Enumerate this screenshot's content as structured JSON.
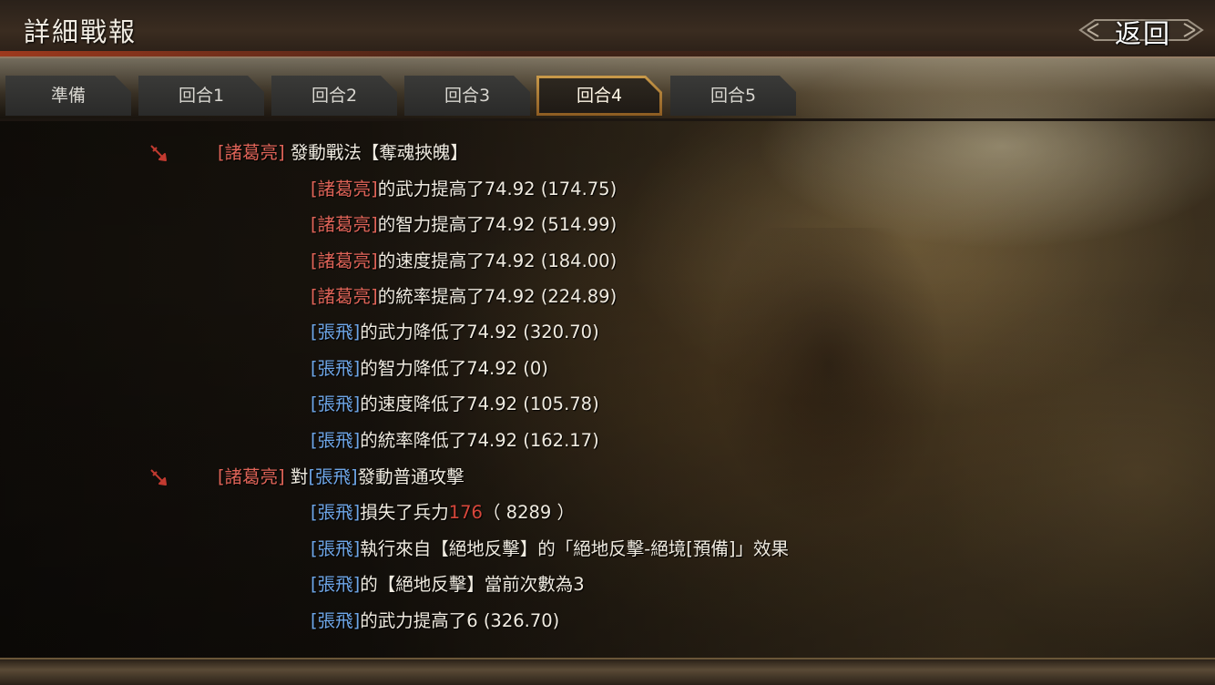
{
  "header": {
    "title": "詳細戰報",
    "back_label": "返回"
  },
  "tabs": [
    {
      "label": "準備",
      "active": false
    },
    {
      "label": "回合1",
      "active": false
    },
    {
      "label": "回合2",
      "active": false
    },
    {
      "label": "回合3",
      "active": false
    },
    {
      "label": "回合4",
      "active": true
    },
    {
      "label": "回合5",
      "active": false
    }
  ],
  "log": {
    "entries": [
      {
        "actor": "[諸葛亮]",
        "text": "發動戰法【奪魂挾魄】",
        "details": [
          {
            "target": "[諸葛亮]",
            "text": "的武力提高了74.92 (174.75)"
          },
          {
            "target": "[諸葛亮]",
            "text": "的智力提高了74.92 (514.99)"
          },
          {
            "target": "[諸葛亮]",
            "text": "的速度提高了74.92 (184.00)"
          },
          {
            "target": "[諸葛亮]",
            "text": "的統率提高了74.92 (224.89)"
          },
          {
            "target": "[張飛]",
            "text": "的武力降低了74.92 (320.70)"
          },
          {
            "target": "[張飛]",
            "text": "的智力降低了74.92 (0)"
          },
          {
            "target": "[張飛]",
            "text": "的速度降低了74.92 (105.78)"
          },
          {
            "target": "[張飛]",
            "text": "的統率降低了74.92 (162.17)"
          }
        ]
      },
      {
        "actor": "[諸葛亮]",
        "text_prefix": "對",
        "target": "[張飛]",
        "text": "發動普通攻擊",
        "details": [
          {
            "target": "[張飛]",
            "text_before": "損失了兵力",
            "damage": "176",
            "text_after": "（ 8289 ）"
          },
          {
            "target": "[張飛]",
            "text": "執行來自【絕地反擊】的「絕地反擊-絕境[預備]」效果"
          },
          {
            "target": "[張飛]",
            "text": "的【絕地反擊】當前次數為3"
          },
          {
            "target": "[張飛]",
            "text": "的武力提高了6 (326.70)"
          }
        ]
      }
    ]
  },
  "colors": {
    "own_general": "#e06458",
    "enemy_general": "#6ea6e8",
    "damage": "#d8473b",
    "active_tab_border": "#c99a4a"
  },
  "icons": {
    "entry_marker": "arrow-icon",
    "back_ornament": "ornament-icon"
  }
}
